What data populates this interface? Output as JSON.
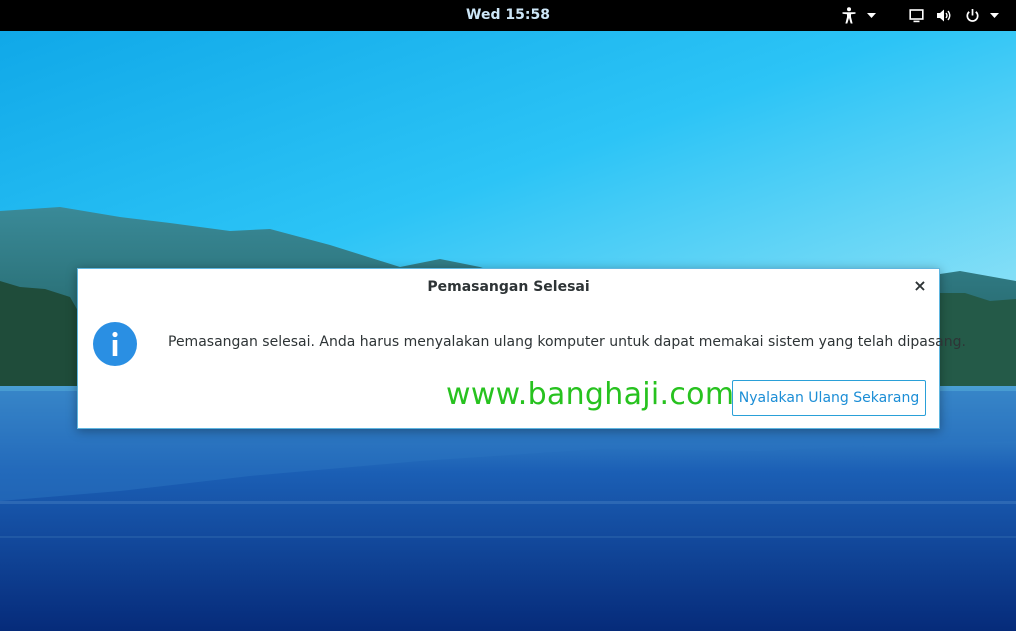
{
  "topbar": {
    "clock": "Wed 15:58",
    "icons": {
      "accessibility": "accessibility-icon",
      "accessibility_menu": "chevron-down-icon",
      "display": "display-icon",
      "volume": "volume-icon",
      "power": "power-icon",
      "system_menu": "chevron-down-icon"
    }
  },
  "dialog": {
    "title": "Pemasangan Selesai",
    "close_label": "×",
    "icon": "info-icon",
    "message": "Pemasangan selesai. Anda harus menyalakan ulang komputer untuk dapat memakai sistem yang telah dipasang.",
    "watermark": "www.banghaji.com",
    "restart_button": "Nyalakan Ulang Sekarang"
  },
  "colors": {
    "topbar_bg": "#000000",
    "clock_text": "#cde6f7",
    "dialog_border": "#5fb6e0",
    "info_icon": "#2a8fe3",
    "button_accent": "#1c8ed6",
    "watermark": "#27c21f"
  }
}
